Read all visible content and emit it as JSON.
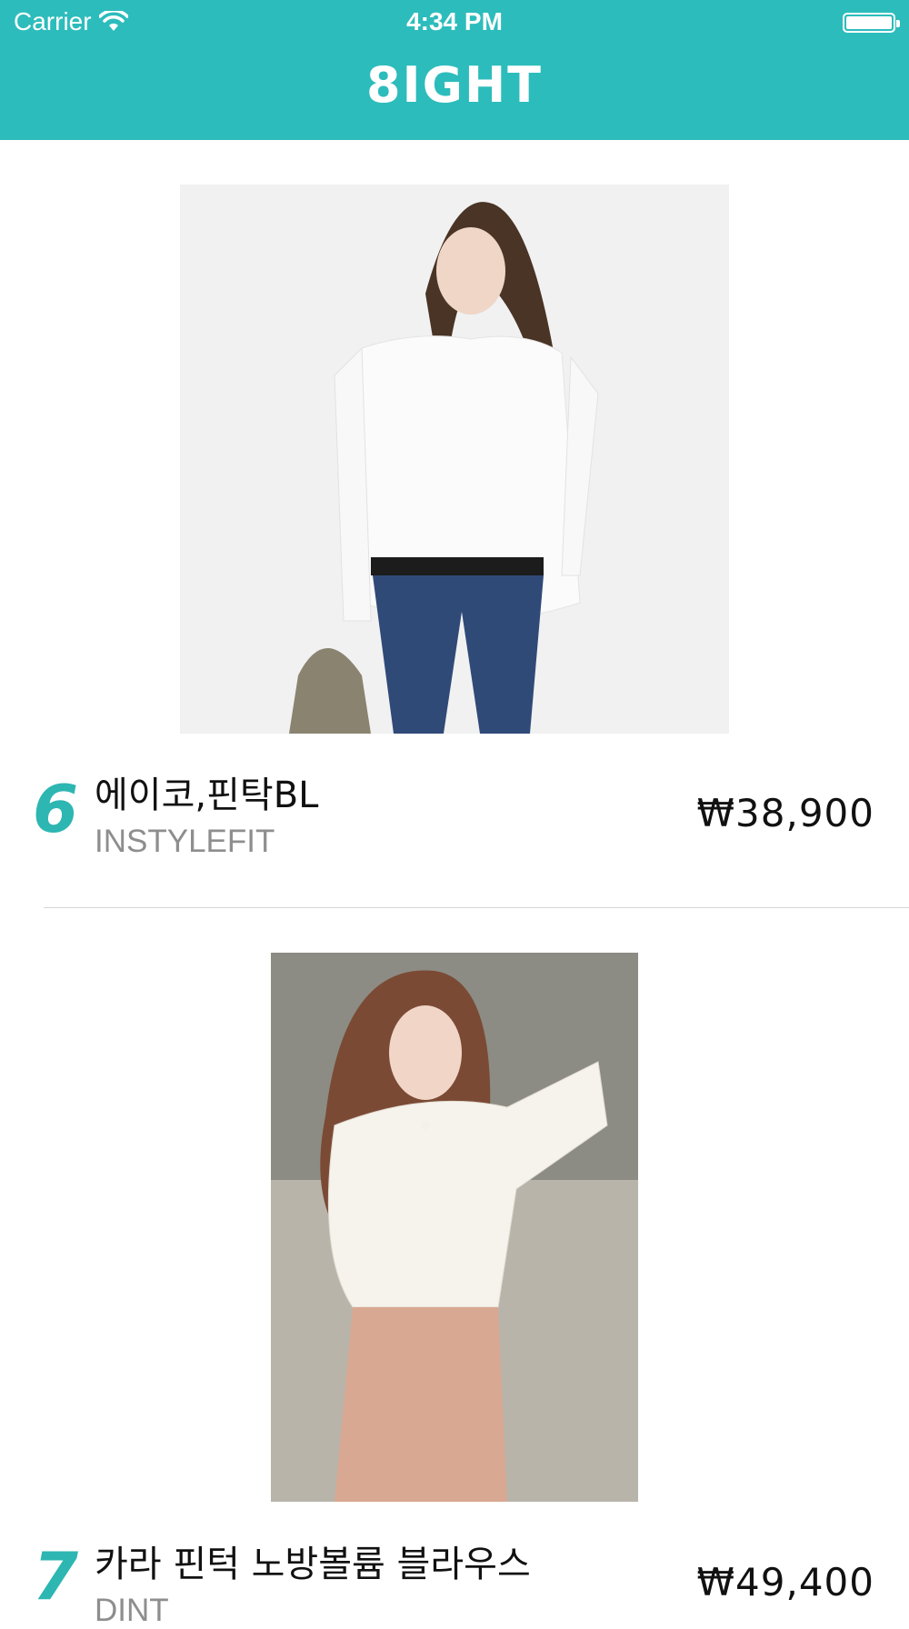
{
  "status_bar": {
    "carrier": "Carrier",
    "time": "4:34 PM"
  },
  "header": {
    "logo": "8IGHT",
    "background_color": "#2dbcbc"
  },
  "products": [
    {
      "rank": "6",
      "title": "에이코,핀탁BL",
      "brand": "INSTYLEFIT",
      "price": "₩38,900"
    },
    {
      "rank": "7",
      "title": "카라 핀턱 노방볼륨 블라우스",
      "brand": "DINT",
      "price": "₩49,400"
    }
  ]
}
